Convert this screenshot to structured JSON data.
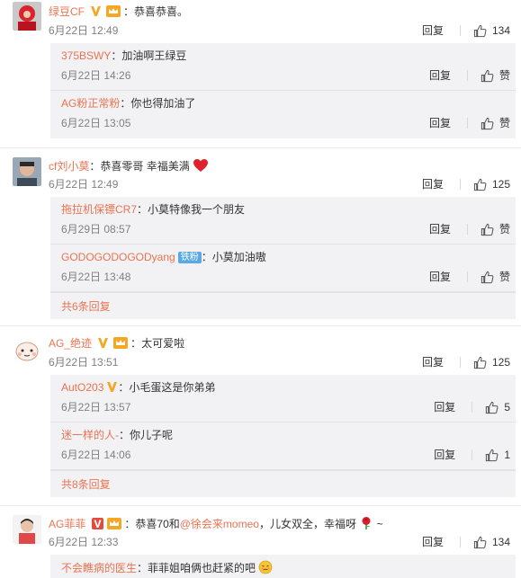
{
  "ui": {
    "reply_label": "回复",
    "like_label": "赞",
    "colon": "："
  },
  "comments": [
    {
      "user": "绿豆CF",
      "text": "恭喜恭喜。",
      "time": "6月22日 12:49",
      "likes": "134",
      "replies": [
        {
          "user": "375BSWY",
          "text": "加油啊王绿豆",
          "time": "6月22日 14:26",
          "likes": "赞"
        },
        {
          "user": "AG粉正常粉",
          "text": "你也得加油了",
          "time": "6月22日 13:05",
          "likes": "赞"
        }
      ]
    },
    {
      "user": "cf刘小莫",
      "text": "恭喜零哥  幸福美满",
      "time": "6月22日 12:49",
      "likes": "125",
      "replies": [
        {
          "user": "拖拉机保镖CR7",
          "text": "小莫特像我一个朋友",
          "time": "6月29日 08:57",
          "likes": "赞"
        },
        {
          "user": "GODOGODOGODyang",
          "fan_badge": "铁粉",
          "text": "小莫加油嗷",
          "time": "6月22日 13:48",
          "likes": "赞"
        }
      ],
      "more": "共6条回复"
    },
    {
      "user": "AG_绝迹",
      "text": "太可爱啦",
      "time": "6月22日 13:51",
      "likes": "125",
      "replies": [
        {
          "user": "AutO203",
          "text": "小毛蛋这是你弟弟",
          "time": "6月22日 13:57",
          "likes": "5"
        },
        {
          "user": "迷一样的人-",
          "text": "你儿子呢",
          "time": "6月22日 14:06",
          "likes": "1"
        }
      ],
      "more": "共8条回复"
    },
    {
      "user": "AG菲菲",
      "text_before": "恭喜70和",
      "mention": "@徐会来momeo",
      "text_after": "，儿女双全，幸福呀",
      "text_tail": "~",
      "time": "6月22日 12:33",
      "likes": "134",
      "replies": [
        {
          "user": "不会瞧病的医生",
          "text": "菲菲姐咱俩也赶紧的吧"
        }
      ]
    }
  ],
  "colors": {
    "username": "#eb7350",
    "reply_bg": "#f2f2f5",
    "time": "#808080"
  }
}
